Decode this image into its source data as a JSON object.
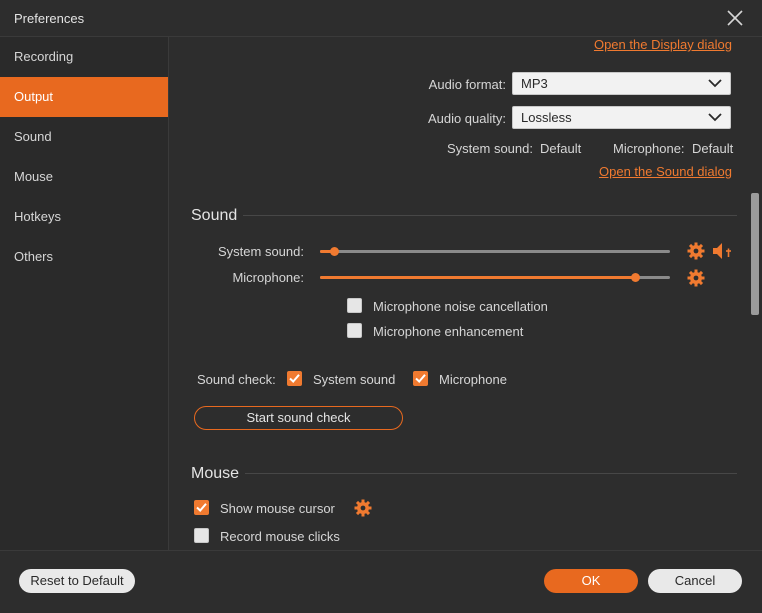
{
  "window": {
    "title": "Preferences"
  },
  "sidebar": {
    "items": [
      {
        "label": "Recording",
        "active": false
      },
      {
        "label": "Output",
        "active": true
      },
      {
        "label": "Sound",
        "active": false
      },
      {
        "label": "Mouse",
        "active": false
      },
      {
        "label": "Hotkeys",
        "active": false
      },
      {
        "label": "Others",
        "active": false
      }
    ]
  },
  "output": {
    "display_link": "Open the Display dialog",
    "audio_format_label": "Audio format:",
    "audio_format_value": "MP3",
    "audio_quality_label": "Audio quality:",
    "audio_quality_value": "Lossless",
    "system_sound_label": "System sound:",
    "system_sound_value": "Default",
    "microphone_label": "Microphone:",
    "microphone_value": "Default",
    "sound_link": "Open the Sound dialog"
  },
  "sound": {
    "title": "Sound",
    "system_sound_label": "System sound:",
    "system_sound_level": 0.04,
    "microphone_label": "Microphone:",
    "microphone_level": 0.9,
    "noise_cancel_label": "Microphone noise cancellation",
    "noise_cancel_checked": false,
    "enhancement_label": "Microphone enhancement",
    "enhancement_checked": false,
    "sound_check_label": "Sound check:",
    "check_system_label": "System sound",
    "check_system_checked": true,
    "check_mic_label": "Microphone",
    "check_mic_checked": true,
    "start_check_label": "Start sound check"
  },
  "mouse": {
    "title": "Mouse",
    "show_cursor_label": "Show mouse cursor",
    "show_cursor_checked": true,
    "record_clicks_label": "Record mouse clicks",
    "record_clicks_checked": false
  },
  "footer": {
    "reset_label": "Reset to Default",
    "ok_label": "OK",
    "cancel_label": "Cancel"
  },
  "colors": {
    "accent": "#e8691f",
    "background": "#2d2d2d"
  }
}
